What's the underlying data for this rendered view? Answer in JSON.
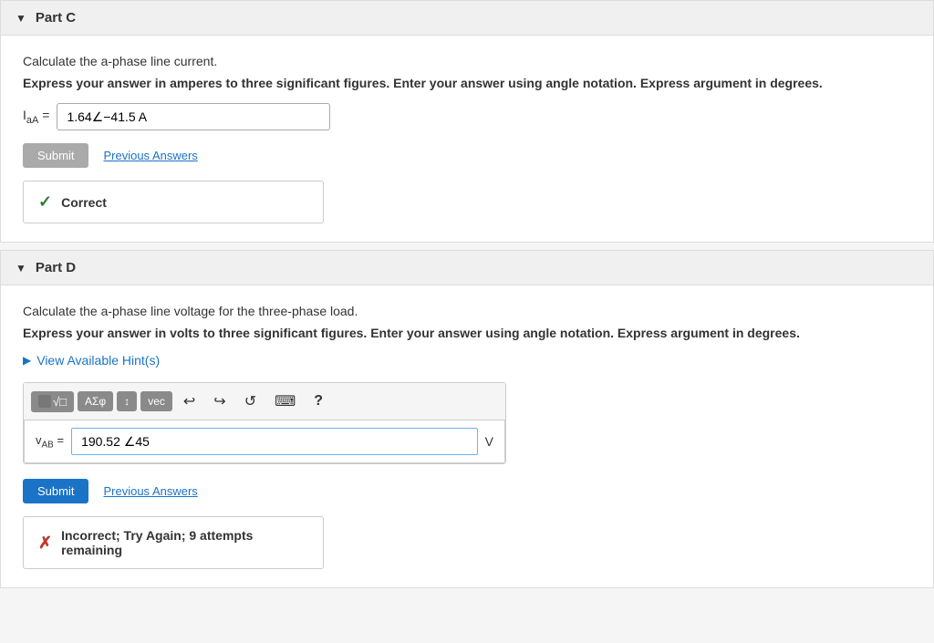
{
  "partC": {
    "label": "Part C",
    "description": "Calculate the a-phase line current.",
    "instruction": "Express your answer in amperes to three significant figures. Enter your answer using angle notation. Express argument in degrees.",
    "answer_label_html": "I<sub>aA</sub> =",
    "answer_value": "1.64∠−41.5 A",
    "submit_label": "Submit",
    "previous_answers_label": "Previous Answers",
    "result_status": "correct",
    "result_text": "Correct"
  },
  "partD": {
    "label": "Part D",
    "description": "Calculate the a-phase line voltage for the three-phase load.",
    "instruction": "Express your answer in volts to three significant figures. Enter your answer using angle notation. Express argument in degrees.",
    "hint_label": "View Available Hint(s)",
    "answer_label_html": "v<sub>AB</sub> =",
    "answer_value": "190.52 ∠45",
    "answer_unit": "V",
    "submit_label": "Submit",
    "previous_answers_label": "Previous Answers",
    "toolbar": {
      "btn1": "■√□",
      "btn2": "ΑΣφ",
      "btn3": "↕",
      "btn4": "vec",
      "undo": "↩",
      "redo": "↪",
      "reset": "↺",
      "keyboard": "⌨",
      "help": "?"
    },
    "result_status": "incorrect",
    "result_text": "Incorrect; Try Again; 9 attempts remaining"
  },
  "colors": {
    "correct_green": "#2e7d32",
    "incorrect_red": "#c0392b",
    "link_blue": "#1a73c7",
    "submit_active": "#1a73c7",
    "submit_disabled": "#aaa",
    "toolbar_bg": "#8a8a8a"
  }
}
